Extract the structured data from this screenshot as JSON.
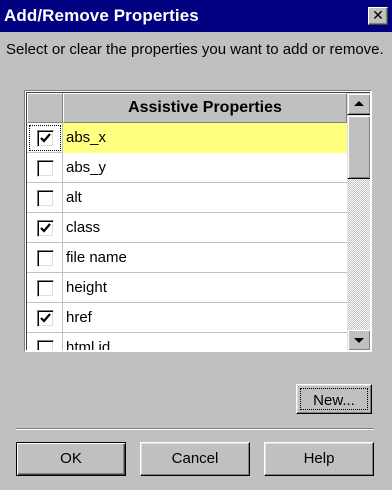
{
  "window": {
    "title": "Add/Remove Properties",
    "close_glyph": "✕"
  },
  "instructions": "Select or clear the properties you want to add or remove.",
  "list": {
    "column_header": "Assistive Properties",
    "rows": [
      {
        "name": "abs_x",
        "checked": true,
        "selected": true
      },
      {
        "name": "abs_y",
        "checked": false,
        "selected": false
      },
      {
        "name": "alt",
        "checked": false,
        "selected": false
      },
      {
        "name": "class",
        "checked": true,
        "selected": false
      },
      {
        "name": "file name",
        "checked": false,
        "selected": false
      },
      {
        "name": "height",
        "checked": false,
        "selected": false
      },
      {
        "name": "href",
        "checked": true,
        "selected": false
      },
      {
        "name": "html id",
        "checked": false,
        "selected": false
      }
    ]
  },
  "buttons": {
    "new_label": "New...",
    "ok_label": "OK",
    "cancel_label": "Cancel",
    "help_label": "Help"
  },
  "colors": {
    "titlebar": "#000080",
    "face": "#c0c0c0",
    "selection": "#ffff80"
  },
  "icons": {
    "close": "close-icon",
    "checkmark": "checkmark-icon",
    "scroll_up": "chevron-up-icon",
    "scroll_down": "chevron-down-icon"
  }
}
